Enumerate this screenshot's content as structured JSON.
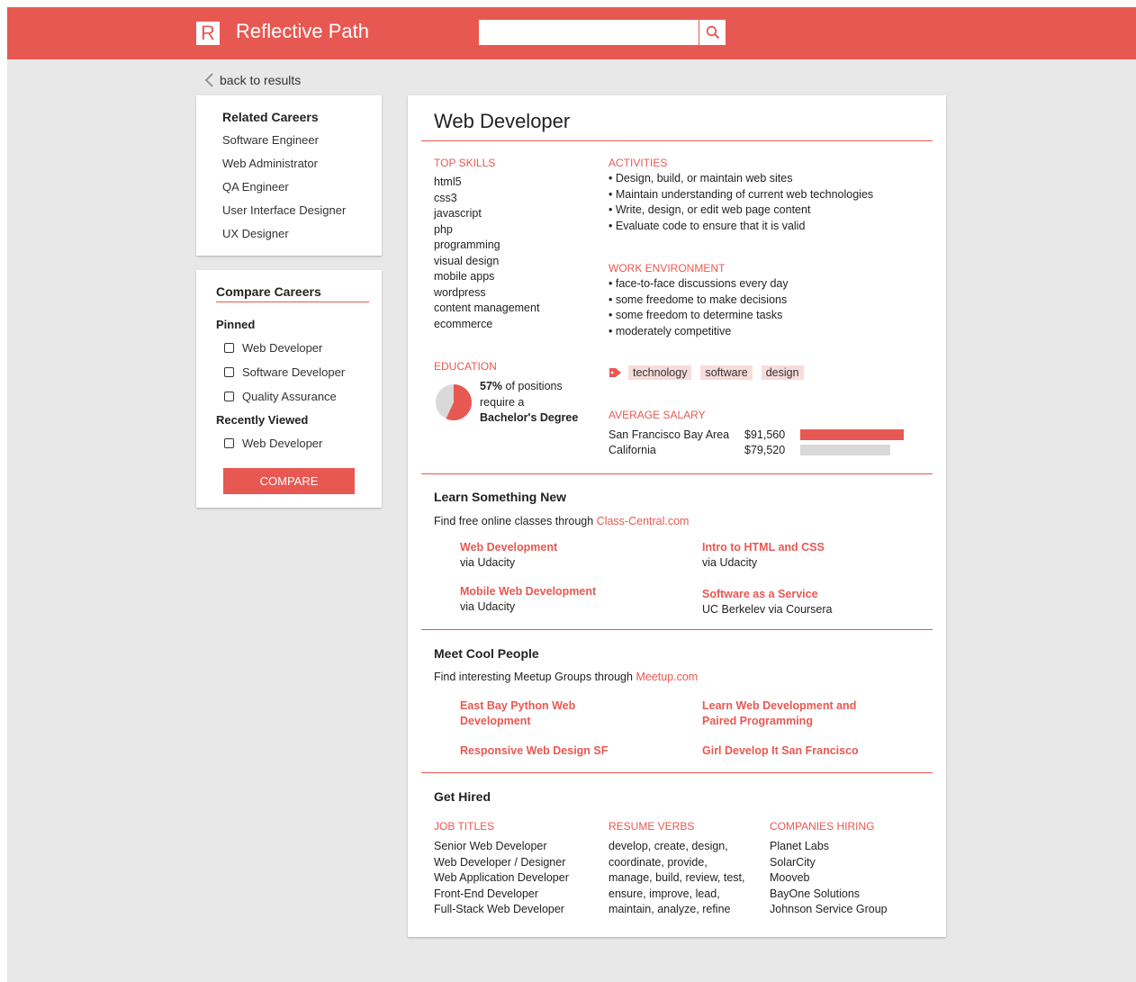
{
  "header": {
    "logo_letter": "R",
    "brand": "Reflective Path",
    "search_placeholder": "",
    "search_icon": "search-icon"
  },
  "back_link": "back to results",
  "related": {
    "title": "Related Careers",
    "items": [
      "Software Engineer",
      "Web Administrator",
      "QA Engineer",
      "User Interface Designer",
      "UX Designer"
    ]
  },
  "compare": {
    "title": "Compare Careers",
    "pinned_label": "Pinned",
    "pinned": [
      "Web Developer",
      "Software Developer",
      "Quality Assurance"
    ],
    "recent_label": "Recently Viewed",
    "recent": [
      "Web Developer"
    ],
    "button": "COMPARE"
  },
  "career": {
    "title": "Web Developer",
    "skills_label": "TOP SKILLS",
    "skills": [
      "html5",
      "css3",
      "javascript",
      "php",
      "programming",
      "visual design",
      "mobile apps",
      "wordpress",
      "content management",
      "ecommerce"
    ],
    "activities_label": "ACTIVITIES",
    "activities": [
      "Design, build, or maintain web sites",
      "Maintain understanding of current web technologies",
      "Write, design, or edit web page content",
      "Evaluate code to ensure that it is valid"
    ],
    "work_env_label": "WORK ENVIRONMENT",
    "work_env": [
      "face-to-face discussions every day",
      "some freedome to make decisions",
      "some freedom to determine tasks",
      "moderately competitive"
    ],
    "tags": [
      "technology",
      "software",
      "design"
    ],
    "education_label": "EDUCATION",
    "education_pct": "57%",
    "education_pct_value": 57,
    "education_line1": " of positions",
    "education_line2": "require a",
    "education_degree": "Bachelor's Degree",
    "salary_label": "AVERAGE SALARY",
    "salaries": [
      {
        "region": "San Francisco Bay Area",
        "amount": "$91,560",
        "value": 91560
      },
      {
        "region": "California",
        "amount": "$79,520",
        "value": 79520
      }
    ]
  },
  "learn": {
    "title": "Learn Something New",
    "intro": "Find free online classes through ",
    "link": "Class-Central.com",
    "courses": [
      {
        "title": "Web Development",
        "sub": "via Udacity"
      },
      {
        "title": "Intro to HTML and CSS",
        "sub": "via Udacity"
      },
      {
        "title": "Mobile Web Development",
        "sub": "via Udacity"
      },
      {
        "title": "Software as a Service",
        "sub": "UC Berkelev via Coursera"
      }
    ]
  },
  "meet": {
    "title": "Meet Cool People",
    "intro": "Find interesting Meetup Groups through ",
    "link": "Meetup.com",
    "groups": [
      "East Bay Python Web",
      "Development",
      "Learn Web Development and",
      "Paired Programming",
      "Responsive Web Design SF",
      "Girl Develop It San Francisco"
    ]
  },
  "hired": {
    "title": "Get Hired",
    "job_titles_label": "JOB TITLES",
    "job_titles": [
      "Senior Web Developer",
      "Web Developer / Designer",
      "Web Application Developer",
      "Front-End Developer",
      "Full-Stack Web Developer"
    ],
    "verbs_label": "RESUME VERBS",
    "verbs": [
      "develop, create, design,",
      "coordinate, provide,",
      "manage, build, review, test,",
      "ensure, improve, lead,",
      "maintain, analyze, refine"
    ],
    "companies_label": "COMPANIES HIRING",
    "companies": [
      "Planet Labs",
      "SolarCity",
      "Mooveb",
      "BayOne Solutions",
      "Johnson Service Group"
    ]
  },
  "colors": {
    "accent": "#e85852",
    "tag_bg": "#f7dcda",
    "bar_gray": "#d9d9d9"
  }
}
